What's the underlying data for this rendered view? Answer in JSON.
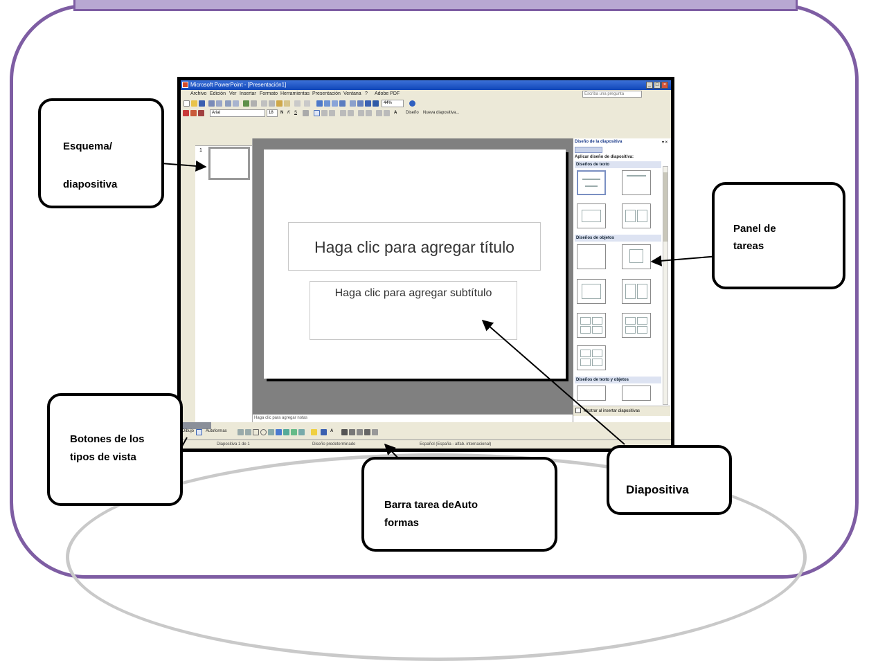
{
  "window": {
    "title": "Microsoft PowerPoint - [Presentación1]",
    "menus": [
      "Archivo",
      "Edición",
      "Ver",
      "Insertar",
      "Formato",
      "Herramientas",
      "Presentación",
      "Ventana",
      "?",
      "Adobe PDF"
    ],
    "help_placeholder": "Escriba una pregunta"
  },
  "toolbar": {
    "font": "Arial",
    "size": "18",
    "zoom": "44%",
    "design_label": "Diseño",
    "new_slide_label": "Nueva diapositiva..."
  },
  "slide": {
    "title_placeholder": "Haga clic para agregar título",
    "subtitle_placeholder": "Haga clic para agregar subtítulo",
    "thumbnail_number": "1"
  },
  "notes": {
    "placeholder": "Haga clic para agregar notas"
  },
  "task_pane": {
    "title": "Diseño de la diapositiva",
    "apply_label": "Aplicar diseño de diapositiva:",
    "sections": [
      "Diseños de texto",
      "Diseños de objetos",
      "Diseños de texto y objetos"
    ],
    "show_checkbox": "Mostrar al insertar diapositivas"
  },
  "drawing_toolbar": {
    "draw_label": "Dibujo",
    "autoshapes_label": "Autoformas"
  },
  "status_bar": {
    "slide": "Diapositiva 1 de 1",
    "design": "Diseño predeterminado",
    "language": "Español (España - alfab. internacional)"
  },
  "callouts": {
    "esquema": [
      "Esquema/",
      "diapositiva"
    ],
    "panel": [
      "Panel de",
      "tareas"
    ],
    "botones": [
      "Botones de los",
      "tipos de vista"
    ],
    "barra": [
      "Barra tarea deAuto",
      "formas"
    ],
    "diapositiva": [
      "Diapositiva"
    ]
  }
}
